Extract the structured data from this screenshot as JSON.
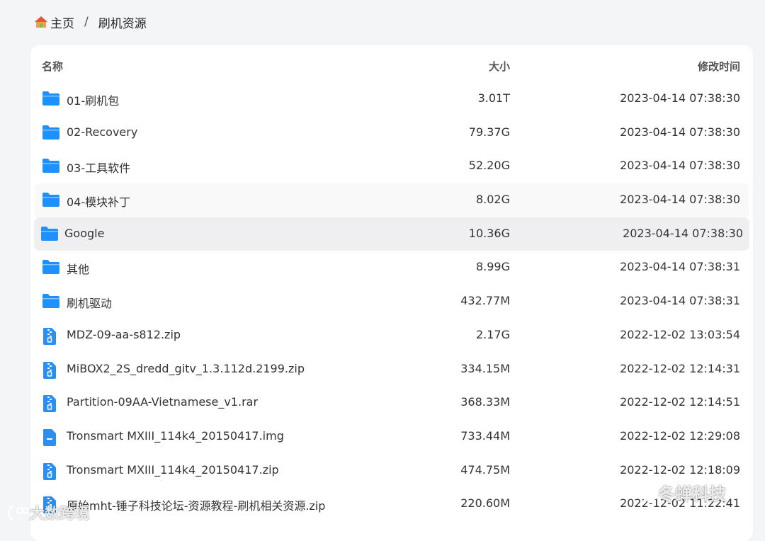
{
  "breadcrumb": {
    "home_label": "主页",
    "separator": "/",
    "current": "刷机资源"
  },
  "table": {
    "headers": {
      "name": "名称",
      "size": "大小",
      "time": "修改时间"
    },
    "rows": [
      {
        "type": "folder",
        "name": "01-刷机包",
        "size": "3.01T",
        "time": "2023-04-14 07:38:30"
      },
      {
        "type": "folder",
        "name": "02-Recovery",
        "size": "79.37G",
        "time": "2023-04-14 07:38:30"
      },
      {
        "type": "folder",
        "name": "03-工具软件",
        "size": "52.20G",
        "time": "2023-04-14 07:38:30"
      },
      {
        "type": "folder",
        "name": "04-模块补丁",
        "size": "8.02G",
        "time": "2023-04-14 07:38:30"
      },
      {
        "type": "folder",
        "name": "Google",
        "size": "10.36G",
        "time": "2023-04-14 07:38:30"
      },
      {
        "type": "folder",
        "name": "其他",
        "size": "8.99G",
        "time": "2023-04-14 07:38:31"
      },
      {
        "type": "folder",
        "name": "刷机驱动",
        "size": "432.77M",
        "time": "2023-04-14 07:38:31"
      },
      {
        "type": "zip",
        "name": "MDZ-09-aa-s812.zip",
        "size": "2.17G",
        "time": "2022-12-02 13:03:54"
      },
      {
        "type": "zip",
        "name": "MiBOX2_2S_dredd_gitv_1.3.112d.2199.zip",
        "size": "334.15M",
        "time": "2022-12-02 12:14:31"
      },
      {
        "type": "zip",
        "name": "Partition-09AA-Vietnamese_v1.rar",
        "size": "368.33M",
        "time": "2022-12-02 12:14:51"
      },
      {
        "type": "file",
        "name": "Tronsmart MXIII_114k4_20150417.img",
        "size": "733.44M",
        "time": "2022-12-02 12:29:08"
      },
      {
        "type": "zip",
        "name": "Tronsmart MXIII_114k4_20150417.zip",
        "size": "474.75M",
        "time": "2022-12-02 12:18:09"
      },
      {
        "type": "zip",
        "name": "原始mht-锤子科技论坛-资源教程-刷机相关资源.zip",
        "size": "220.60M",
        "time": "2022-12-02 11:22:41"
      }
    ],
    "hover_index": 3,
    "selected_index": 4
  },
  "watermarks": {
    "left": "大数跨境",
    "right": "冬蝉科技"
  },
  "colors": {
    "folder": "#1e90ff",
    "file": "#2b8ef0"
  }
}
